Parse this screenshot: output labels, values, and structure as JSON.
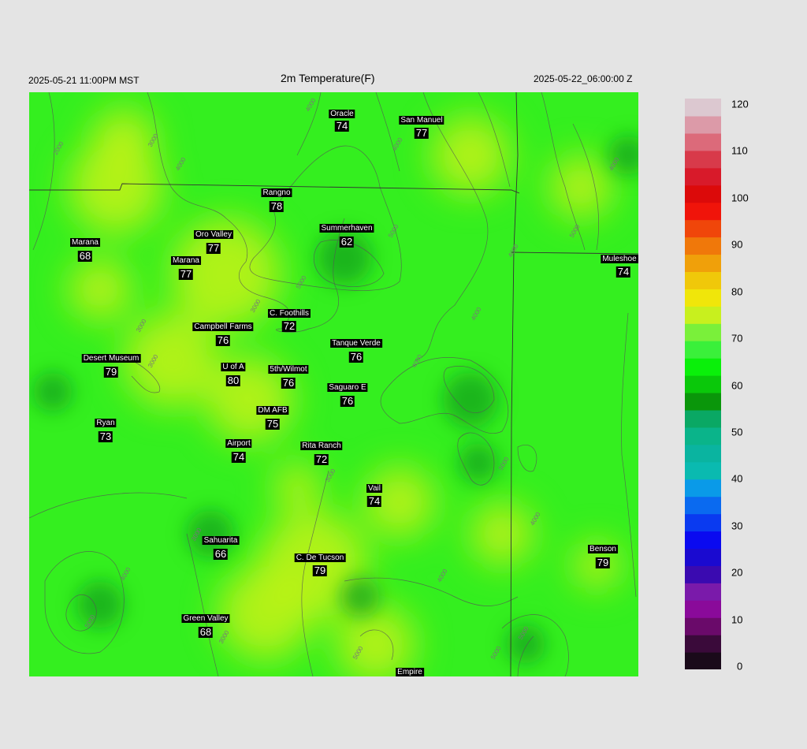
{
  "header": {
    "valid_local": "2025-05-21 11:00PM MST",
    "title": "2m Temperature(F)",
    "valid_utc": "2025-05-22_06:00:00 Z"
  },
  "stations": [
    {
      "name": "Oracle",
      "value": "74"
    },
    {
      "name": "San Manuel",
      "value": "77"
    },
    {
      "name": "Rangno",
      "value": "78"
    },
    {
      "name": "Marana",
      "value": "68"
    },
    {
      "name": "Oro Valley",
      "value": "77"
    },
    {
      "name": "Summerhaven",
      "value": "62"
    },
    {
      "name": "Marana",
      "value": "77"
    },
    {
      "name": "Muleshoe R",
      "value": "74"
    },
    {
      "name": "C. Foothills",
      "value": "72"
    },
    {
      "name": "Campbell Farms",
      "value": "76"
    },
    {
      "name": "Tanque Verde",
      "value": "76"
    },
    {
      "name": "Desert Museum",
      "value": "79"
    },
    {
      "name": "U of A",
      "value": "80"
    },
    {
      "name": "5th/Wilmot",
      "value": "76"
    },
    {
      "name": "Saguaro E",
      "value": "76"
    },
    {
      "name": "DM AFB",
      "value": "75"
    },
    {
      "name": "Ryan",
      "value": "73"
    },
    {
      "name": "Airport",
      "value": "74"
    },
    {
      "name": "Rita Ranch",
      "value": "72"
    },
    {
      "name": "Vail",
      "value": "74"
    },
    {
      "name": "Sahuarita",
      "value": "66"
    },
    {
      "name": "C. De Tucson",
      "value": "79"
    },
    {
      "name": "Benson",
      "value": "79"
    },
    {
      "name": "Green Valley",
      "value": "68"
    },
    {
      "name": "Empire",
      "value": ""
    }
  ],
  "contour_labels": [
    "2000",
    "3000",
    "4000",
    "4000",
    "4000",
    "5000",
    "5000",
    "4000",
    "5000",
    "4000",
    "3000",
    "4000",
    "3000",
    "3000",
    "5000",
    "4000",
    "3000",
    "4000",
    "3000",
    "5000",
    "4000",
    "3000",
    "5000",
    "5000",
    "5000",
    "4000"
  ],
  "colorbar": {
    "ticks": [
      "120",
      "110",
      "100",
      "90",
      "80",
      "70",
      "60",
      "50",
      "40",
      "30",
      "20",
      "10",
      "0"
    ],
    "min": 0,
    "max": 120,
    "colors": [
      "#1a0a1a",
      "#3a0a3a",
      "#6a0a6a",
      "#8a0a9a",
      "#7a1aaa",
      "#3a0ab0",
      "#1a0ad0",
      "#0a0af0",
      "#0a3af0",
      "#0a6af0",
      "#0a9ae8",
      "#0abab0",
      "#0ab4a0",
      "#0ab48a",
      "#0aa864",
      "#0a960a",
      "#0ac80a",
      "#0af00a",
      "#3af03a",
      "#7af03a",
      "#c8f01e",
      "#f0e60a",
      "#f0c80a",
      "#f0a00a",
      "#f0780a",
      "#f0460a",
      "#f0140a",
      "#dc0a0a",
      "#d81a2a",
      "#d83a4a",
      "#dc6a7a",
      "#dc9aa8",
      "#dcc8d0"
    ]
  },
  "map_colors": {
    "green": "#22ee22",
    "yellow_green": "#bdf21a",
    "dark_green": "#0a9e1c",
    "lime": "#7fee2a"
  }
}
